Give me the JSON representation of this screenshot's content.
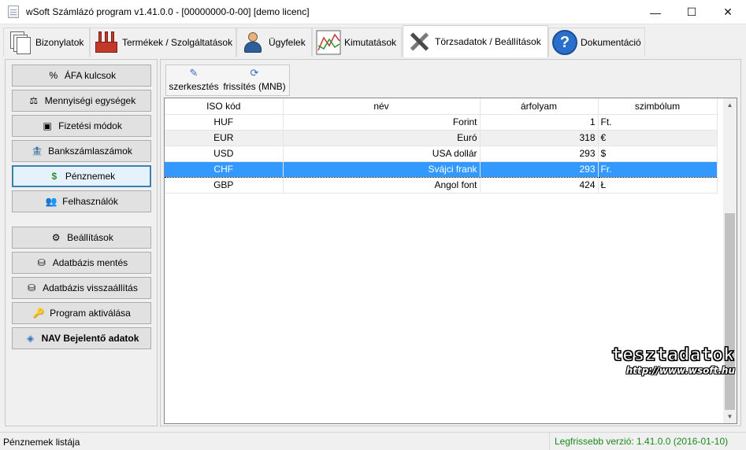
{
  "window": {
    "title": "wSoft Számlázó program v1.41.0.0 - [00000000-0-00] [demo licenc]",
    "minimize": "—",
    "maximize": "☐",
    "close": "✕"
  },
  "tabs": [
    {
      "label": "Bizonylatok",
      "icon": "documents-icon"
    },
    {
      "label": "Termékek / Szolgáltatások",
      "icon": "factory-icon"
    },
    {
      "label": "Ügyfelek",
      "icon": "customer-icon"
    },
    {
      "label": "Kimutatások",
      "icon": "chart-icon"
    },
    {
      "label": "Törzsadatok / Beállítások",
      "icon": "tools-icon",
      "active": true
    },
    {
      "label": "Dokumentáció",
      "icon": "help-icon"
    }
  ],
  "sidebar": {
    "items": [
      {
        "label": "ÁFA kulcsok",
        "icon": "%"
      },
      {
        "label": "Mennyiségi egységek",
        "icon": "⚖"
      },
      {
        "label": "Fizetési módok",
        "icon": "▣"
      },
      {
        "label": "Bankszámlaszámok",
        "icon": "🏦"
      },
      {
        "label": "Pénznemek",
        "icon": "$",
        "selected": true
      },
      {
        "label": "Felhasználók",
        "icon": "👥"
      },
      {
        "label": "Beállítások",
        "icon": "⚙"
      },
      {
        "label": "Adatbázis mentés",
        "icon": "⛁"
      },
      {
        "label": "Adatbázis visszaállítás",
        "icon": "⛁"
      },
      {
        "label": "Program aktiválása",
        "icon": "🔑"
      },
      {
        "label": "NAV Bejelentő adatok",
        "icon": "◈",
        "bold": true
      }
    ]
  },
  "toolbar": {
    "edit_label": "szerkesztés",
    "refresh_label": "frissítés (MNB)"
  },
  "table": {
    "columns": [
      "ISO kód",
      "név",
      "árfolyam",
      "szimbólum"
    ],
    "rows": [
      [
        "HUF",
        "Forint",
        "1",
        "Ft."
      ],
      [
        "EUR",
        "Euró",
        "318",
        "€"
      ],
      [
        "USD",
        "USA dollár",
        "293",
        "$"
      ],
      [
        "CHF",
        "Svájci frank",
        "293",
        "Fr."
      ],
      [
        "GBP",
        "Angol font",
        "424",
        "Ł"
      ]
    ],
    "selected_row": 3
  },
  "watermark": {
    "line1": "tesztadatok",
    "line2": "http://www.wsoft.hu"
  },
  "status": {
    "left": "Pénznemek listája",
    "right": "Legfrissebb verzió: 1.41.0.0 (2016-01-10)"
  },
  "colors": {
    "selection": "#3399ff",
    "selected_button_border": "#3c7fb1",
    "status_green": "#1b8a1b"
  }
}
